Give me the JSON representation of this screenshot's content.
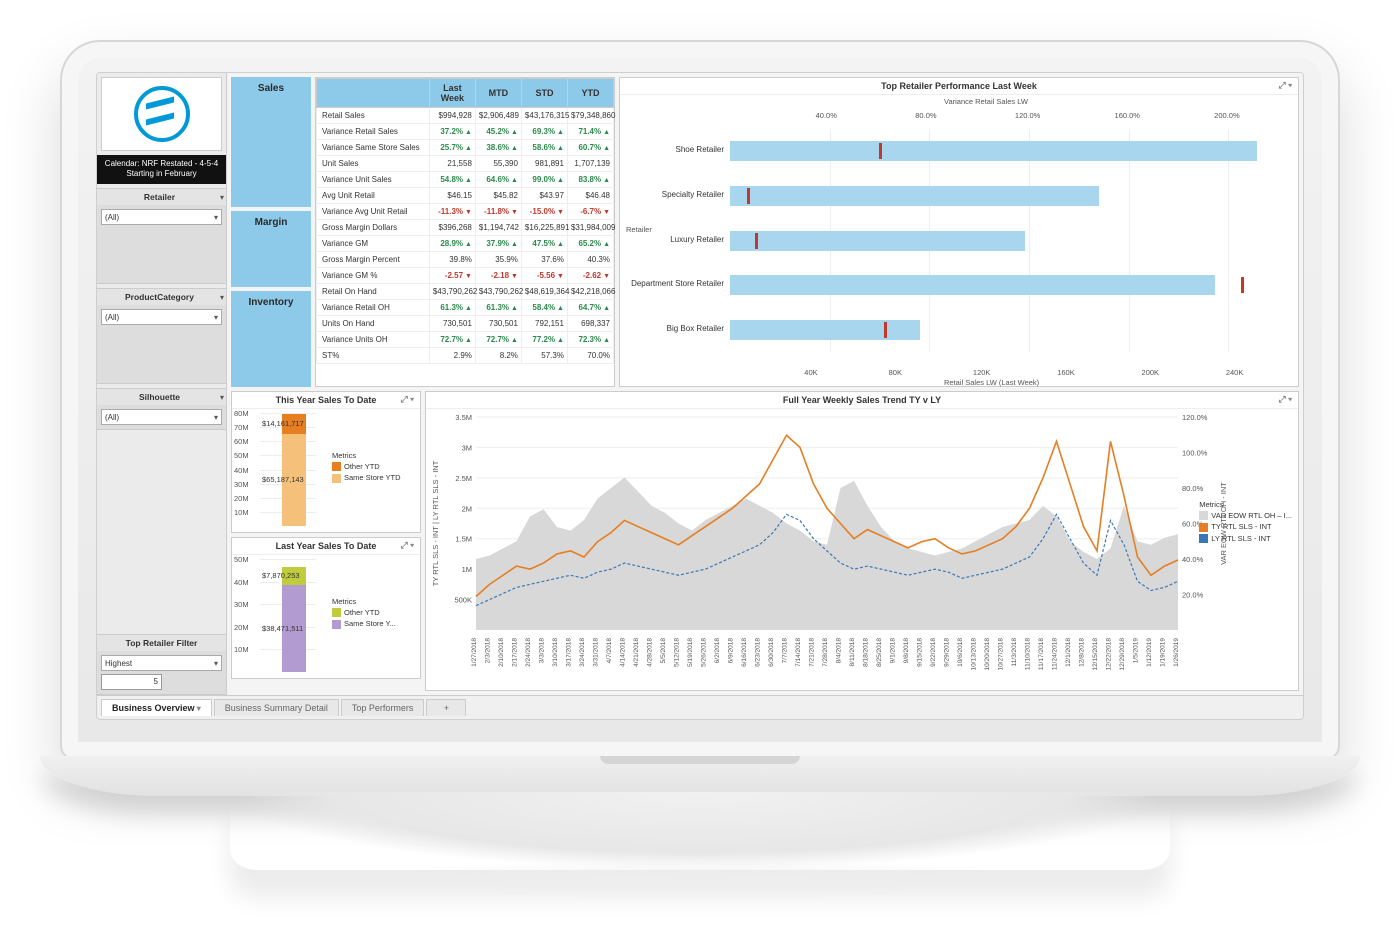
{
  "sidebar": {
    "calendar_banner": "Calendar: NRF Restated - 4-5-4 Starting in February",
    "filters": [
      {
        "label": "Retailer",
        "value": "(All)",
        "tall": true
      },
      {
        "label": "ProductCategory",
        "value": "(All)",
        "tall": true
      },
      {
        "label": "Silhouette",
        "value": "(All)",
        "tall": false
      }
    ],
    "top_filter": {
      "label": "Top Retailer Filter",
      "value": "Highest",
      "num": "5"
    }
  },
  "sections": {
    "sales": "Sales",
    "margin": "Margin",
    "inventory": "Inventory"
  },
  "kpi_table": {
    "headers": [
      "",
      "Last Week",
      "MTD",
      "STD",
      "YTD"
    ],
    "rows": [
      {
        "m": "Retail Sales",
        "v": [
          "$994,928",
          "$2,906,489",
          "$43,176,315",
          "$79,348,860"
        ],
        "d": [
          0,
          0,
          0,
          0
        ]
      },
      {
        "m": "Variance Retail Sales",
        "v": [
          "37.2%",
          "45.2%",
          "69.3%",
          "71.4%"
        ],
        "d": [
          1,
          1,
          1,
          1
        ]
      },
      {
        "m": "Variance Same Store Sales",
        "v": [
          "25.7%",
          "38.6%",
          "58.6%",
          "60.7%"
        ],
        "d": [
          1,
          1,
          1,
          1
        ]
      },
      {
        "m": "Unit Sales",
        "v": [
          "21,558",
          "55,390",
          "981,891",
          "1,707,139"
        ],
        "d": [
          0,
          0,
          0,
          0
        ]
      },
      {
        "m": "Variance Unit Sales",
        "v": [
          "54.8%",
          "64.6%",
          "99.0%",
          "83.8%"
        ],
        "d": [
          1,
          1,
          1,
          1
        ]
      },
      {
        "m": "Avg Unit Retail",
        "v": [
          "$46.15",
          "$45.82",
          "$43.97",
          "$46.48"
        ],
        "d": [
          0,
          0,
          0,
          0
        ]
      },
      {
        "m": "Variance Avg Unit Retail",
        "v": [
          "-11.3%",
          "-11.8%",
          "-15.0%",
          "-6.7%"
        ],
        "d": [
          -1,
          -1,
          -1,
          -1
        ]
      },
      {
        "m": "Gross Margin Dollars",
        "v": [
          "$396,268",
          "$1,194,742",
          "$16,225,891",
          "$31,984,009"
        ],
        "d": [
          0,
          0,
          0,
          0
        ]
      },
      {
        "m": "Variance GM",
        "v": [
          "28.9%",
          "37.9%",
          "47.5%",
          "65.2%"
        ],
        "d": [
          1,
          1,
          1,
          1
        ]
      },
      {
        "m": "Gross Margin Percent",
        "v": [
          "39.8%",
          "35.9%",
          "37.6%",
          "40.3%"
        ],
        "d": [
          0,
          0,
          0,
          0
        ]
      },
      {
        "m": "Variance GM %",
        "v": [
          "-2.57",
          "-2.18",
          "-5.56",
          "-2.62"
        ],
        "d": [
          -1,
          -1,
          -1,
          -1
        ]
      },
      {
        "m": "Retail On Hand",
        "v": [
          "$43,790,262",
          "$43,790,262",
          "$48,619,364",
          "$42,218,066"
        ],
        "d": [
          0,
          0,
          0,
          0
        ]
      },
      {
        "m": "Variance Retail OH",
        "v": [
          "61.3%",
          "61.3%",
          "58.4%",
          "64.7%"
        ],
        "d": [
          1,
          1,
          1,
          1
        ]
      },
      {
        "m": "Units On Hand",
        "v": [
          "730,501",
          "730,501",
          "792,151",
          "698,337"
        ],
        "d": [
          0,
          0,
          0,
          0
        ]
      },
      {
        "m": "Variance Units OH",
        "v": [
          "72.7%",
          "72.7%",
          "77.2%",
          "72.3%"
        ],
        "d": [
          1,
          1,
          1,
          1
        ]
      },
      {
        "m": "ST%",
        "v": [
          "2.9%",
          "8.2%",
          "57.3%",
          "70.0%"
        ],
        "d": [
          0,
          0,
          0,
          0
        ]
      }
    ]
  },
  "retail_perf": {
    "title": "Top Retailer Performance Last Week",
    "top_axis_label": "Variance Retail Sales LW",
    "top_ticks": [
      "40.0%",
      "80.0%",
      "120.0%",
      "160.0%",
      "200.0%"
    ],
    "bottom_axis_label": "Retail Sales LW (Last Week)",
    "bottom_ticks": [
      "40K",
      "80K",
      "120K",
      "160K",
      "200K",
      "240K"
    ],
    "y_label": "Retailer",
    "rows": [
      {
        "name": "Shoe Retailer",
        "sales": 250000,
        "var": 0.6
      },
      {
        "name": "Specialty Retailer",
        "sales": 175000,
        "var": 0.07
      },
      {
        "name": "Luxury Retailer",
        "sales": 140000,
        "var": 0.1
      },
      {
        "name": "Department Store Retailer",
        "sales": 230000,
        "var": 2.05
      },
      {
        "name": "Big Box Retailer",
        "sales": 90000,
        "var": 0.62
      }
    ]
  },
  "this_year": {
    "title": "This Year Sales To Date",
    "yticks": [
      "10M",
      "20M",
      "30M",
      "40M",
      "50M",
      "60M",
      "70M",
      "80M"
    ],
    "same": "$65,187,143",
    "other": "$14,161,717",
    "legend_title": "Metrics",
    "legend1": "Other YTD",
    "legend2": "Same Store YTD"
  },
  "last_year": {
    "title": "Last Year Sales To Date",
    "yticks": [
      "10M",
      "20M",
      "30M",
      "40M",
      "50M"
    ],
    "same": "$38,471,511",
    "other": "$7,870,253",
    "legend_title": "Metrics",
    "legend1": "Other YTD",
    "legend2": "Same Store Y..."
  },
  "trend": {
    "title": "Full Year Weekly Sales Trend TY v LY",
    "y_left_label": "TY RTL SLS - INT  |  LY RTL SLS - INT",
    "y_right_label": "VAR EOW RTL OH - INT",
    "y_left_ticks": [
      "500K",
      "1M",
      "1.5M",
      "2M",
      "2.5M",
      "3M",
      "3.5M"
    ],
    "y_right_ticks": [
      "20.0%",
      "40.0%",
      "60.0%",
      "80.0%",
      "100.0%",
      "120.0%"
    ],
    "legend_title": "Metrics",
    "legend": [
      "VAR EOW RTL OH – I...",
      "TY RTL SLS - INT",
      "LY RTL SLS - INT"
    ],
    "x_dates": [
      "1/27/2018",
      "2/3/2018",
      "2/10/2018",
      "2/17/2018",
      "2/24/2018",
      "3/3/2018",
      "3/10/2018",
      "3/17/2018",
      "3/24/2018",
      "3/31/2018",
      "4/7/2018",
      "4/14/2018",
      "4/21/2018",
      "4/28/2018",
      "5/5/2018",
      "5/12/2018",
      "5/19/2018",
      "5/26/2018",
      "6/2/2018",
      "6/9/2018",
      "6/16/2018",
      "6/23/2018",
      "6/30/2018",
      "7/7/2018",
      "7/14/2018",
      "7/21/2018",
      "7/28/2018",
      "8/4/2018",
      "8/11/2018",
      "8/18/2018",
      "8/25/2018",
      "9/1/2018",
      "9/8/2018",
      "9/15/2018",
      "9/22/2018",
      "9/29/2018",
      "10/6/2018",
      "10/13/2018",
      "10/20/2018",
      "10/27/2018",
      "11/3/2018",
      "11/10/2018",
      "11/17/2018",
      "11/24/2018",
      "12/1/2018",
      "12/8/2018",
      "12/15/2018",
      "12/22/2018",
      "12/29/2018",
      "1/5/2019",
      "1/12/2019",
      "1/19/2019",
      "1/26/2019"
    ]
  },
  "tabs": {
    "items": [
      "Business Overview",
      "Business Summary Detail",
      "Top Performers"
    ],
    "add": "+"
  },
  "chart_data": {
    "retailer_bar": {
      "type": "bar",
      "orientation": "horizontal",
      "title": "Top Retailer Performance Last Week",
      "categories": [
        "Shoe Retailer",
        "Specialty Retailer",
        "Luxury Retailer",
        "Department Store Retailer",
        "Big Box Retailer"
      ],
      "series": [
        {
          "name": "Retail Sales LW",
          "values": [
            250000,
            175000,
            140000,
            230000,
            90000
          ],
          "axis": "bottom",
          "unit": "$"
        },
        {
          "name": "Variance Retail Sales LW",
          "values": [
            0.6,
            0.07,
            0.1,
            2.05,
            0.62
          ],
          "axis": "top",
          "unit": "%",
          "marker": "tick"
        }
      ],
      "x_bottom": {
        "label": "Retail Sales LW (Last Week)",
        "ticks": [
          40000,
          80000,
          120000,
          160000,
          200000,
          240000
        ]
      },
      "x_top": {
        "label": "Variance Retail Sales LW",
        "ticks": [
          0.4,
          0.8,
          1.2,
          1.6,
          2.0
        ]
      }
    },
    "this_year_sales": {
      "type": "bar",
      "stacked": true,
      "title": "This Year Sales To Date",
      "categories": [
        "YTD"
      ],
      "series": [
        {
          "name": "Same Store YTD",
          "values": [
            65187143
          ]
        },
        {
          "name": "Other YTD",
          "values": [
            14161717
          ]
        }
      ],
      "ylim": [
        0,
        80000000
      ]
    },
    "last_year_sales": {
      "type": "bar",
      "stacked": true,
      "title": "Last Year Sales To Date",
      "categories": [
        "YTD"
      ],
      "series": [
        {
          "name": "Same Store YTD",
          "values": [
            38471511
          ]
        },
        {
          "name": "Other YTD",
          "values": [
            7870253
          ]
        }
      ],
      "ylim": [
        0,
        50000000
      ]
    },
    "weekly_trend": {
      "type": "line",
      "title": "Full Year Weekly Sales Trend TY v LY",
      "x": [
        "1/27/2018",
        "2/3/2018",
        "2/10/2018",
        "2/17/2018",
        "2/24/2018",
        "3/3/2018",
        "3/10/2018",
        "3/17/2018",
        "3/24/2018",
        "3/31/2018",
        "4/7/2018",
        "4/14/2018",
        "4/21/2018",
        "4/28/2018",
        "5/5/2018",
        "5/12/2018",
        "5/19/2018",
        "5/26/2018",
        "6/2/2018",
        "6/9/2018",
        "6/16/2018",
        "6/23/2018",
        "6/30/2018",
        "7/7/2018",
        "7/14/2018",
        "7/21/2018",
        "7/28/2018",
        "8/4/2018",
        "8/11/2018",
        "8/18/2018",
        "8/25/2018",
        "9/1/2018",
        "9/8/2018",
        "9/15/2018",
        "9/22/2018",
        "9/29/2018",
        "10/6/2018",
        "10/13/2018",
        "10/20/2018",
        "10/27/2018",
        "11/3/2018",
        "11/10/2018",
        "11/17/2018",
        "11/24/2018",
        "12/1/2018",
        "12/8/2018",
        "12/15/2018",
        "12/22/2018",
        "12/29/2018",
        "1/5/2019",
        "1/12/2019",
        "1/19/2019",
        "1/26/2019"
      ],
      "series": [
        {
          "name": "VAR EOW RTL OH - INT",
          "axis": "right",
          "style": "area",
          "values": [
            0.4,
            0.42,
            0.46,
            0.5,
            0.64,
            0.68,
            0.58,
            0.56,
            0.62,
            0.74,
            0.8,
            0.86,
            0.78,
            0.7,
            0.66,
            0.6,
            0.56,
            0.62,
            0.66,
            0.7,
            0.74,
            0.7,
            0.66,
            0.6,
            0.56,
            0.5,
            0.48,
            0.8,
            0.84,
            0.7,
            0.58,
            0.5,
            0.46,
            0.44,
            0.42,
            0.44,
            0.46,
            0.5,
            0.54,
            0.58,
            0.6,
            0.62,
            0.7,
            0.64,
            0.5,
            0.44,
            0.4,
            0.46,
            0.7,
            0.5,
            0.48,
            0.52,
            0.54
          ]
        },
        {
          "name": "TY RTL SLS - INT",
          "axis": "left",
          "style": "line",
          "values": [
            550000,
            750000,
            900000,
            1050000,
            1000000,
            1100000,
            1250000,
            1300000,
            1200000,
            1450000,
            1600000,
            1800000,
            1700000,
            1600000,
            1500000,
            1400000,
            1550000,
            1700000,
            1850000,
            2000000,
            2200000,
            2400000,
            2800000,
            3200000,
            3000000,
            2400000,
            2000000,
            1750000,
            1500000,
            1650000,
            1550000,
            1450000,
            1350000,
            1450000,
            1500000,
            1350000,
            1250000,
            1300000,
            1400000,
            1500000,
            1700000,
            2000000,
            2500000,
            3100000,
            2400000,
            1700000,
            1300000,
            3100000,
            2200000,
            1200000,
            900000,
            1050000,
            1150000
          ]
        },
        {
          "name": "LY RTL SLS - INT",
          "axis": "left",
          "style": "dashed",
          "values": [
            400000,
            500000,
            600000,
            700000,
            750000,
            800000,
            850000,
            900000,
            850000,
            950000,
            1000000,
            1100000,
            1050000,
            1000000,
            950000,
            900000,
            950000,
            1000000,
            1100000,
            1200000,
            1300000,
            1400000,
            1600000,
            1900000,
            1800000,
            1500000,
            1300000,
            1100000,
            1000000,
            1050000,
            1000000,
            950000,
            900000,
            950000,
            1000000,
            950000,
            850000,
            900000,
            950000,
            1000000,
            1100000,
            1200000,
            1500000,
            1900000,
            1500000,
            1100000,
            900000,
            1800000,
            1400000,
            800000,
            650000,
            700000,
            800000
          ]
        }
      ],
      "y_left": {
        "lim": [
          0,
          3500000
        ],
        "label": "TY RTL SLS - INT | LY RTL SLS - INT"
      },
      "y_right": {
        "lim": [
          0,
          1.2
        ],
        "label": "VAR EOW RTL OH - INT"
      }
    }
  }
}
